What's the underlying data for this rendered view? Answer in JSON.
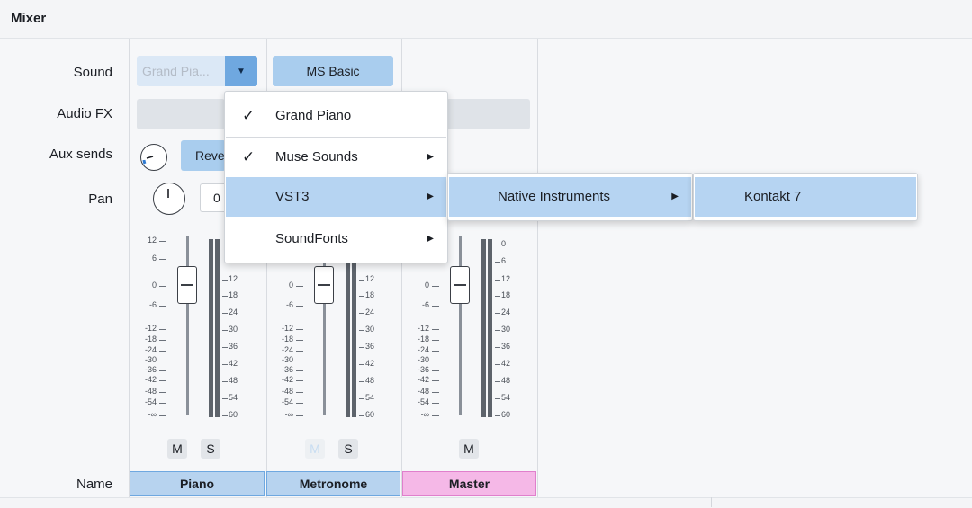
{
  "panel": {
    "title": "Mixer"
  },
  "rows": {
    "sound": "Sound",
    "audio_fx": "Audio FX",
    "aux_sends": "Aux sends",
    "pan": "Pan",
    "name": "Name"
  },
  "strips": [
    {
      "name": "Piano",
      "sound": "Grand Pia...",
      "aux": "Reve",
      "pan": "0",
      "mute": "M",
      "solo": "S"
    },
    {
      "name": "Metronome",
      "sound": "MS Basic",
      "mute": "M",
      "solo": "S"
    },
    {
      "name": "Master",
      "mute": "M"
    }
  ],
  "fader_scale": [
    "12",
    "6",
    "0",
    "-6",
    "-12",
    "-18",
    "-24",
    "-30",
    "-36",
    "-42",
    "-48",
    "-54",
    "-∞"
  ],
  "meter_scale": [
    "0",
    "6",
    "12",
    "18",
    "24",
    "30",
    "36",
    "42",
    "48",
    "54",
    "60"
  ],
  "sound_menu": {
    "items": [
      {
        "label": "Grand Piano",
        "checked": true
      },
      {
        "label": "Muse Sounds",
        "checked": true,
        "submenu": true
      },
      {
        "label": "VST3",
        "highlighted": true,
        "submenu": true
      },
      {
        "label": "SoundFonts",
        "submenu": true
      }
    ]
  },
  "vst3_submenu": {
    "items": [
      {
        "label": "Native Instruments",
        "highlighted": true,
        "submenu": true
      }
    ]
  },
  "ni_submenu": {
    "items": [
      {
        "label": "Kontakt 7",
        "highlighted": true
      }
    ]
  },
  "icons": {
    "dropdown": "triangle-down-icon",
    "check": "check-icon",
    "submenu": "triangle-right-icon"
  },
  "colors": {
    "accent": "#a9cdee",
    "highlight": "#b6d4f2",
    "master": "#f5b8e7"
  }
}
